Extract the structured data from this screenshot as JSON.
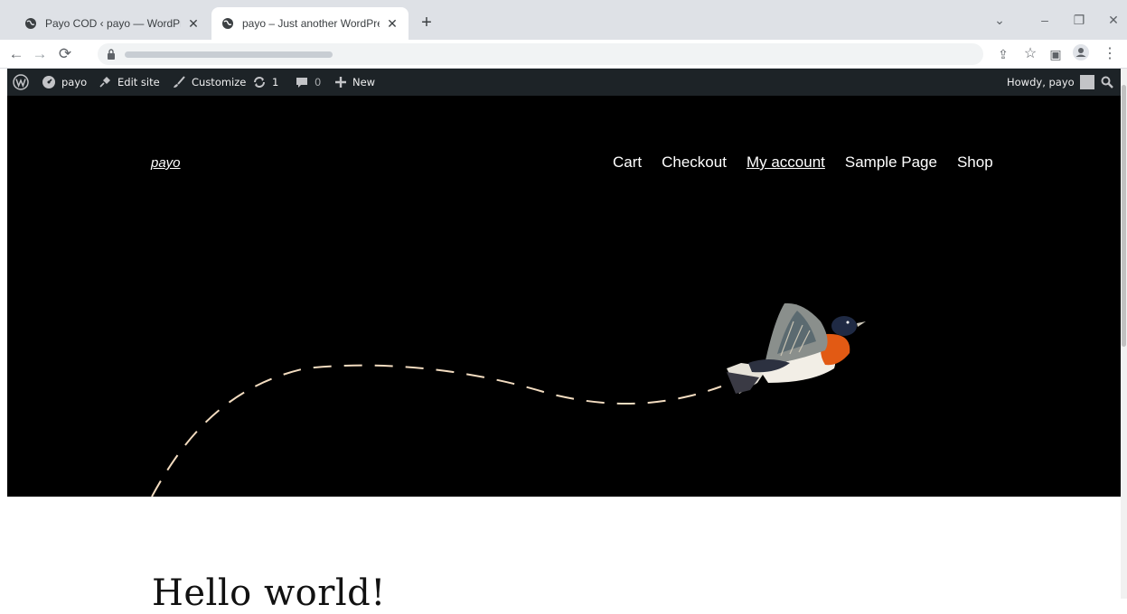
{
  "browser": {
    "tabs": [
      {
        "title": "Payo COD ‹ payo — WordPress",
        "active": false
      },
      {
        "title": "payo – Just another WordPress si",
        "active": true
      }
    ],
    "new_tab": "+",
    "window_controls": {
      "minimize": "–",
      "maximize": "❐",
      "close": "✕",
      "tab_search": "⌄"
    },
    "nav": {
      "back": "←",
      "forward": "→",
      "reload": "⟳"
    },
    "toolbar_icons": {
      "share": "⇪",
      "bookmark": "☆",
      "side_panel": "▣",
      "menu": "⋮"
    }
  },
  "adminbar": {
    "site": "payo",
    "edit_site": "Edit site",
    "customize": "Customize",
    "updates": "1",
    "comments": "0",
    "new": "New",
    "howdy": "Howdy, payo"
  },
  "site": {
    "title": "payo",
    "nav": [
      "Cart",
      "Checkout",
      "My account",
      "Sample Page",
      "Shop"
    ],
    "current_nav": "My account"
  },
  "post": {
    "title": "Hello world!"
  },
  "colors": {
    "hero_bg": "#000000",
    "adminbar_bg": "#1d2327",
    "dash_line": "#f3dcc0"
  }
}
